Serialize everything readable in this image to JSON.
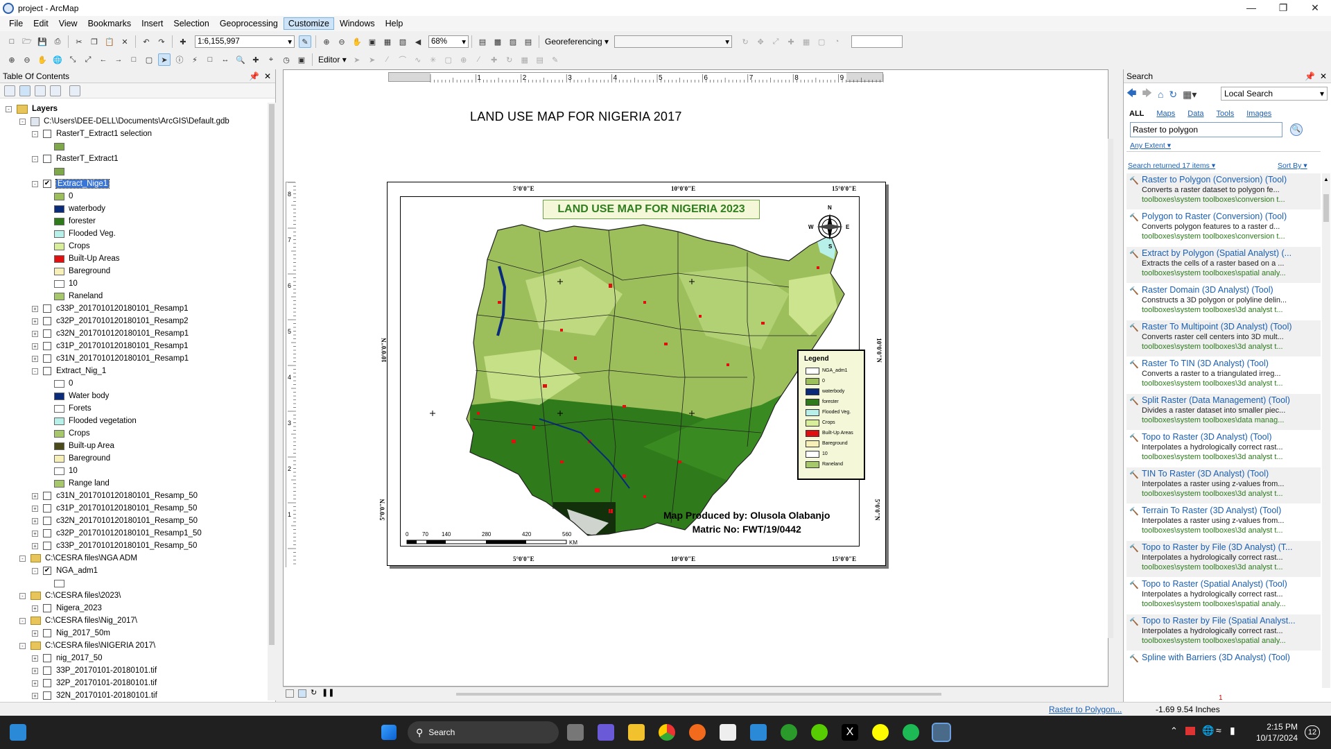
{
  "window": {
    "title": "project - ArcMap"
  },
  "menu": [
    "File",
    "Edit",
    "View",
    "Bookmarks",
    "Insert",
    "Selection",
    "Geoprocessing",
    "Customize",
    "Windows",
    "Help"
  ],
  "toolbar": {
    "scale": "1:6,155,997",
    "zoom": "68%",
    "georeferencing_label": "Georeferencing",
    "editor_label": "Editor"
  },
  "toc": {
    "title": "Table Of Contents",
    "root": "Layers",
    "rows": [
      {
        "level": 1,
        "kind": "db",
        "label": "C:\\Users\\DEE-DELL\\Documents\\ArcGIS\\Default.gdb",
        "pm": "-"
      },
      {
        "level": 2,
        "kind": "layer",
        "label": "RasterT_Extract1 selection",
        "pm": "-",
        "checked": false
      },
      {
        "level": 3,
        "kind": "swatch",
        "label": "",
        "color": "#7fa84a"
      },
      {
        "level": 2,
        "kind": "layer",
        "label": "RasterT_Extract1",
        "pm": "-",
        "checked": false
      },
      {
        "level": 3,
        "kind": "swatch",
        "label": "",
        "color": "#7fa84a"
      },
      {
        "level": 2,
        "kind": "layer",
        "label": "Extract_Nige1",
        "pm": "-",
        "checked": true,
        "selected": true
      },
      {
        "level": 3,
        "kind": "swatch",
        "label": "0",
        "color": "#9cbf5c"
      },
      {
        "level": 3,
        "kind": "swatch",
        "label": "waterbody",
        "color": "#0a2a7a"
      },
      {
        "level": 3,
        "kind": "swatch",
        "label": "forester",
        "color": "#2f7a1a"
      },
      {
        "level": 3,
        "kind": "swatch",
        "label": "Flooded Veg.",
        "color": "#b6f0e8"
      },
      {
        "level": 3,
        "kind": "swatch",
        "label": "Crops",
        "color": "#d8ee9a"
      },
      {
        "level": 3,
        "kind": "swatch",
        "label": "Built-Up Areas",
        "color": "#e01010"
      },
      {
        "level": 3,
        "kind": "swatch",
        "label": "Bareground",
        "color": "#f6f0b8"
      },
      {
        "level": 3,
        "kind": "swatch",
        "label": "10",
        "color": "#ffffff"
      },
      {
        "level": 3,
        "kind": "swatch",
        "label": "Raneland",
        "color": "#a6c86a"
      },
      {
        "level": 2,
        "kind": "layer",
        "label": "c33P_2017010120180101_Resamp1",
        "pm": "+",
        "checked": false
      },
      {
        "level": 2,
        "kind": "layer",
        "label": "c32P_2017010120180101_Resamp2",
        "pm": "+",
        "checked": false
      },
      {
        "level": 2,
        "kind": "layer",
        "label": "c32N_2017010120180101_Resamp1",
        "pm": "+",
        "checked": false
      },
      {
        "level": 2,
        "kind": "layer",
        "label": "c31P_2017010120180101_Resamp1",
        "pm": "+",
        "checked": false
      },
      {
        "level": 2,
        "kind": "layer",
        "label": "c31N_2017010120180101_Resamp1",
        "pm": "+",
        "checked": false
      },
      {
        "level": 2,
        "kind": "layer",
        "label": "Extract_Nig_1",
        "pm": "-",
        "checked": false
      },
      {
        "level": 3,
        "kind": "swatch",
        "label": "0",
        "color": "#ffffff"
      },
      {
        "level": 3,
        "kind": "swatch",
        "label": "Water body",
        "color": "#0a2a7a"
      },
      {
        "level": 3,
        "kind": "swatch",
        "label": "Forets",
        "color": "#ffffff"
      },
      {
        "level": 3,
        "kind": "swatch",
        "label": "Flooded vegetation",
        "color": "#b6f0e8"
      },
      {
        "level": 3,
        "kind": "swatch",
        "label": "Crops",
        "color": "#a6c86a"
      },
      {
        "level": 3,
        "kind": "swatch",
        "label": "Built-up Area",
        "color": "#4a4a1a"
      },
      {
        "level": 3,
        "kind": "swatch",
        "label": "Bareground",
        "color": "#f6f0b8"
      },
      {
        "level": 3,
        "kind": "swatch",
        "label": "10",
        "color": "#ffffff"
      },
      {
        "level": 3,
        "kind": "swatch",
        "label": "Range land",
        "color": "#a6c86a"
      },
      {
        "level": 2,
        "kind": "layer",
        "label": "c31N_2017010120180101_Resamp_50",
        "pm": "+",
        "checked": false
      },
      {
        "level": 2,
        "kind": "layer",
        "label": "c31P_2017010120180101_Resamp_50",
        "pm": "+",
        "checked": false
      },
      {
        "level": 2,
        "kind": "layer",
        "label": "c32N_2017010120180101_Resamp_50",
        "pm": "+",
        "checked": false
      },
      {
        "level": 2,
        "kind": "layer",
        "label": "c32P_2017010120180101_Resamp1_50",
        "pm": "+",
        "checked": false
      },
      {
        "level": 2,
        "kind": "layer",
        "label": "c33P_2017010120180101_Resamp_50",
        "pm": "+",
        "checked": false
      },
      {
        "level": 1,
        "kind": "folder",
        "label": "C:\\CESRA files\\NGA ADM",
        "pm": "-"
      },
      {
        "level": 2,
        "kind": "layer",
        "label": "NGA_adm1",
        "pm": "-",
        "checked": true
      },
      {
        "level": 3,
        "kind": "swatch",
        "label": "",
        "color": "#ffffff"
      },
      {
        "level": 1,
        "kind": "folder",
        "label": "C:\\CESRA files\\2023\\",
        "pm": "-"
      },
      {
        "level": 2,
        "kind": "layer",
        "label": "Nigera_2023",
        "pm": "+",
        "checked": false
      },
      {
        "level": 1,
        "kind": "folder",
        "label": "C:\\CESRA files\\Nig_2017\\",
        "pm": "-"
      },
      {
        "level": 2,
        "kind": "layer",
        "label": "Nig_2017_50m",
        "pm": "+",
        "checked": false
      },
      {
        "level": 1,
        "kind": "folder",
        "label": "C:\\CESRA files\\NIGERIA 2017\\",
        "pm": "-"
      },
      {
        "level": 2,
        "kind": "layer",
        "label": "nig_2017_50",
        "pm": "+",
        "checked": false
      },
      {
        "level": 2,
        "kind": "layer",
        "label": "33P_20170101-20180101.tif",
        "pm": "+",
        "checked": false
      },
      {
        "level": 2,
        "kind": "layer",
        "label": "32P_20170101-20180101.tif",
        "pm": "+",
        "checked": false
      },
      {
        "level": 2,
        "kind": "layer",
        "label": "32N_20170101-20180101.tif",
        "pm": "+",
        "checked": false
      }
    ]
  },
  "layout": {
    "page_title": "LAND USE MAP FOR NIGERIA 2017",
    "map_title": "LAND USE MAP FOR NIGERIA 2023",
    "top_ticks": [
      "5°0'0\"E",
      "10°0'0\"E",
      "15°0'0\"E"
    ],
    "bottom_ticks": [
      "5°0'0\"E",
      "10°0'0\"E",
      "15°0'0\"E"
    ],
    "left_ticks": [
      "10°0'0\"N",
      "5°0'0\"N"
    ],
    "right_ticks": [
      "10°0'0\"N",
      "5°0'0\"N"
    ],
    "ruler_top": [
      "1",
      "2",
      "3",
      "4",
      "5",
      "6",
      "7",
      "8",
      "9",
      "10"
    ],
    "ruler_left": [
      "8",
      "7",
      "6",
      "5",
      "4",
      "3",
      "2",
      "1"
    ],
    "compass": {
      "n": "N",
      "s": "S",
      "e": "E",
      "w": "W"
    },
    "legend": {
      "title": "Legend",
      "items": [
        {
          "label": "NGA_adm1",
          "color": "#ffffff"
        },
        {
          "label": "0",
          "color": "#9cbf5c"
        },
        {
          "label": "waterbody",
          "color": "#0a2a7a"
        },
        {
          "label": "forester",
          "color": "#2f7a1a"
        },
        {
          "label": "Flooded Veg.",
          "color": "#b6f0e8"
        },
        {
          "label": "Crops",
          "color": "#d8ee9a"
        },
        {
          "label": "Built-Up Areas",
          "color": "#e01010"
        },
        {
          "label": "Bareground",
          "color": "#f6f0b8"
        },
        {
          "label": "10",
          "color": "#ffffff"
        },
        {
          "label": "Raneland",
          "color": "#a6c86a"
        }
      ]
    },
    "credit_line1": "Map Produced by: Olusola Olabanjo",
    "credit_line2": "Matric No: FWT/19/0442",
    "scale_labels": [
      "0",
      "70",
      "140",
      "280",
      "420",
      "560"
    ],
    "scale_unit": "KM"
  },
  "search": {
    "title": "Search",
    "scope": "Local Search",
    "tabs": [
      "ALL",
      "Maps",
      "Data",
      "Tools",
      "Images"
    ],
    "query": "Raster to polygon",
    "extent": "Any Extent",
    "returned": "Search returned 17 items",
    "sort": "Sort By",
    "results": [
      {
        "title": "Raster to Polygon (Conversion) (Tool)",
        "desc": "Converts a raster dataset to polygon fe...",
        "path": "toolboxes\\system toolboxes\\conversion t..."
      },
      {
        "title": "Polygon to Raster (Conversion) (Tool)",
        "desc": "Converts polygon features to a raster d...",
        "path": "toolboxes\\system toolboxes\\conversion t..."
      },
      {
        "title": "Extract by Polygon (Spatial Analyst) (...",
        "desc": "Extracts the cells of a raster based on a ...",
        "path": "toolboxes\\system toolboxes\\spatial analy..."
      },
      {
        "title": "Raster Domain (3D Analyst) (Tool)",
        "desc": "Constructs a 3D polygon or polyline delin...",
        "path": "toolboxes\\system toolboxes\\3d analyst t..."
      },
      {
        "title": "Raster To Multipoint (3D Analyst) (Tool)",
        "desc": "Converts raster cell centers into 3D mult...",
        "path": "toolboxes\\system toolboxes\\3d analyst t..."
      },
      {
        "title": "Raster To TIN (3D Analyst) (Tool)",
        "desc": "Converts a raster to a triangulated irreg...",
        "path": "toolboxes\\system toolboxes\\3d analyst t..."
      },
      {
        "title": "Split Raster (Data Management) (Tool)",
        "desc": "Divides a raster dataset into smaller piec...",
        "path": "toolboxes\\system toolboxes\\data manag..."
      },
      {
        "title": "Topo to Raster (3D Analyst) (Tool)",
        "desc": "Interpolates a hydrologically correct rast...",
        "path": "toolboxes\\system toolboxes\\3d analyst t..."
      },
      {
        "title": "TIN To Raster (3D Analyst) (Tool)",
        "desc": "Interpolates a raster using z-values from...",
        "path": "toolboxes\\system toolboxes\\3d analyst t..."
      },
      {
        "title": "Terrain To Raster (3D Analyst) (Tool)",
        "desc": "Interpolates a raster using z-values from...",
        "path": "toolboxes\\system toolboxes\\3d analyst t..."
      },
      {
        "title": "Topo to Raster by File (3D Analyst) (T...",
        "desc": "Interpolates a hydrologically correct rast...",
        "path": "toolboxes\\system toolboxes\\3d analyst t..."
      },
      {
        "title": "Topo to Raster (Spatial Analyst) (Tool)",
        "desc": "Interpolates a hydrologically correct rast...",
        "path": "toolboxes\\system toolboxes\\spatial analy..."
      },
      {
        "title": "Topo to Raster by File (Spatial Analyst...",
        "desc": "Interpolates a hydrologically correct rast...",
        "path": "toolboxes\\system toolboxes\\spatial analy..."
      },
      {
        "title": "Spline with Barriers (3D Analyst) (Tool)",
        "desc": "",
        "path": ""
      }
    ]
  },
  "status": {
    "message": "Raster to Polygon...",
    "coords": "-1.69  9.54 Inches",
    "page_num": "1"
  },
  "taskbar": {
    "search_label": "Search",
    "time": "2:15 PM",
    "date": "10/17/2024",
    "badge": "12"
  }
}
